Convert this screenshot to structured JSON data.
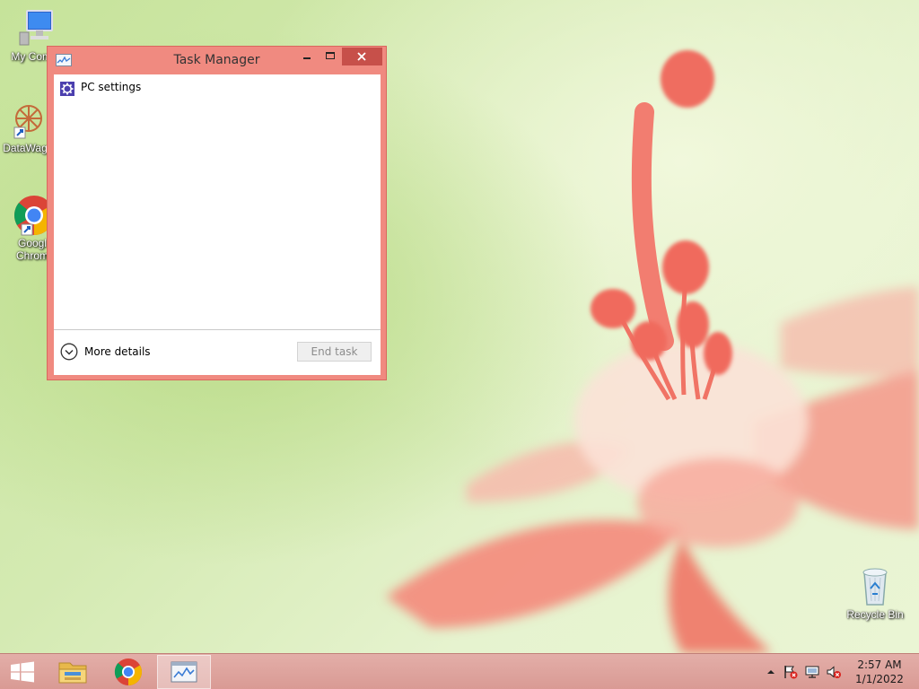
{
  "desktop": {
    "icons": [
      {
        "label": "My Comp",
        "icon": "computer-icon"
      },
      {
        "label": "DataWag",
        "icon": "datawag-icon"
      },
      {
        "label": "Googl",
        "label2": "Chrom",
        "icon": "chrome-icon"
      },
      {
        "label": "Recycle Bin",
        "icon": "recycle-bin-icon"
      }
    ]
  },
  "window": {
    "title": "Task Manager",
    "buttons": {
      "minimize": "minimize-icon",
      "maximize": "maximize-icon",
      "close": "close-icon"
    },
    "apps": [
      {
        "name": "PC settings",
        "icon": "gear-icon"
      }
    ],
    "more_details_label": "More details",
    "end_task_label": "End task"
  },
  "taskbar": {
    "items": [
      "start-icon",
      "file-explorer-icon",
      "chrome-icon",
      "task-manager-icon"
    ],
    "tray": [
      "show-hidden-icons-chevron",
      "action-center-flag-icon",
      "network-icon",
      "volume-muted-icon"
    ],
    "time": "2:57 AM",
    "date": "1/1/2022"
  },
  "colors": {
    "accent": "#f08a80",
    "close_button": "#c7504a",
    "taskbar": "#dca19b"
  }
}
